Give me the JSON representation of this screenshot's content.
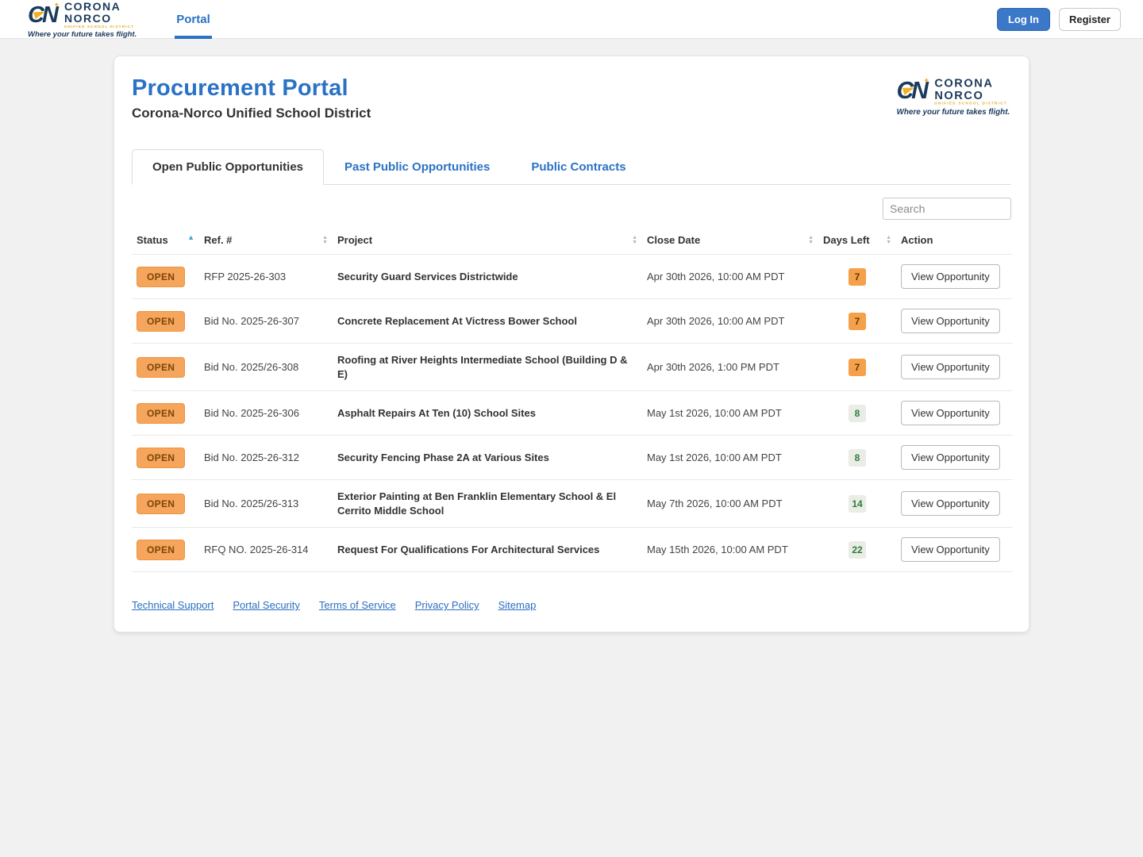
{
  "navbar": {
    "brand": {
      "line1": "CORONA",
      "line2": "NORCO",
      "monogram": "CN",
      "sub": "UNIFIED SCHOOL DISTRICT",
      "tagline": "Where your future takes flight."
    },
    "portal_link": "Portal",
    "login_label": "Log In",
    "register_label": "Register"
  },
  "header": {
    "title": "Procurement Portal",
    "subtitle": "Corona-Norco Unified School District"
  },
  "tabs": [
    {
      "label": "Open Public Opportunities",
      "active": true
    },
    {
      "label": "Past Public Opportunities",
      "active": false
    },
    {
      "label": "Public Contracts",
      "active": false
    }
  ],
  "search": {
    "placeholder": "Search"
  },
  "table": {
    "columns": [
      {
        "label": "Status",
        "sort": "asc"
      },
      {
        "label": "Ref. #",
        "sort": "both"
      },
      {
        "label": "Project",
        "sort": "both"
      },
      {
        "label": "Close Date",
        "sort": "both"
      },
      {
        "label": "Days Left",
        "sort": "both"
      },
      {
        "label": "Action",
        "sort": "none"
      }
    ],
    "action_label": "View Opportunity",
    "rows": [
      {
        "status": "OPEN",
        "ref": "RFP 2025-26-303",
        "project": "Security Guard Services Districtwide",
        "close_date": "Apr 30th 2026, 10:00 AM PDT",
        "days_left": "7",
        "days_left_style": "warn"
      },
      {
        "status": "OPEN",
        "ref": "Bid No. 2025-26-307",
        "project": "Concrete Replacement At Victress Bower School",
        "close_date": "Apr 30th 2026, 10:00 AM PDT",
        "days_left": "7",
        "days_left_style": "warn"
      },
      {
        "status": "OPEN",
        "ref": "Bid No. 2025/26-308",
        "project": "Roofing at River Heights Intermediate School (Building D & E)",
        "close_date": "Apr 30th 2026, 1:00 PM PDT",
        "days_left": "7",
        "days_left_style": "warn"
      },
      {
        "status": "OPEN",
        "ref": "Bid No. 2025-26-306",
        "project": "Asphalt Repairs At Ten (10) School Sites",
        "close_date": "May 1st 2026, 10:00 AM PDT",
        "days_left": "8",
        "days_left_style": "ok"
      },
      {
        "status": "OPEN",
        "ref": "Bid No. 2025-26-312",
        "project": "Security Fencing Phase 2A at Various Sites",
        "close_date": "May 1st 2026, 10:00 AM PDT",
        "days_left": "8",
        "days_left_style": "ok"
      },
      {
        "status": "OPEN",
        "ref": "Bid No. 2025/26-313",
        "project": "Exterior Painting at Ben Franklin Elementary School & El Cerrito Middle School",
        "close_date": "May 7th 2026, 10:00 AM PDT",
        "days_left": "14",
        "days_left_style": "ok"
      },
      {
        "status": "OPEN",
        "ref": "RFQ NO. 2025-26-314",
        "project": "Request For Qualifications For Architectural Services",
        "close_date": "May 15th 2026, 10:00 AM PDT",
        "days_left": "22",
        "days_left_style": "ok"
      }
    ]
  },
  "footer": {
    "links": [
      "Technical Support",
      "Portal Security",
      "Terms of Service",
      "Privacy Policy",
      "Sitemap"
    ]
  },
  "colors": {
    "accent_blue": "#2a72c5",
    "brand_navy": "#1b3a5c",
    "brand_gold": "#f2b01e",
    "open_badge_bg": "#f5a55c",
    "days_warn_bg": "#f5a04a",
    "days_ok_text": "#2f7d3a"
  }
}
